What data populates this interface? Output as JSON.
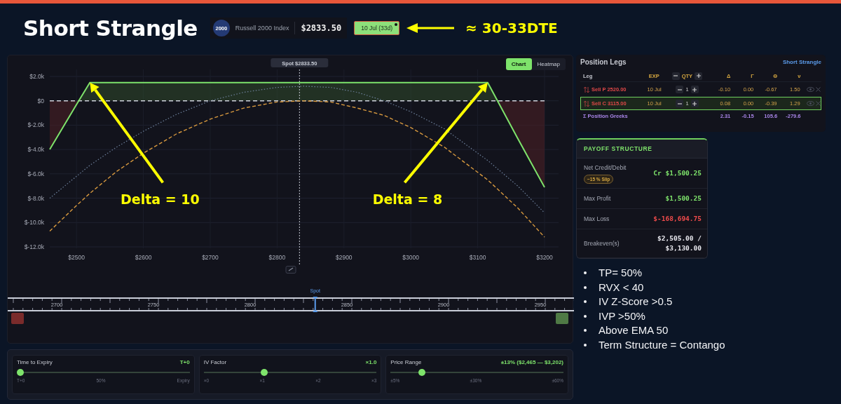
{
  "title": "Short Strangle",
  "underlying": {
    "logo": "2000",
    "name": "Russell 2000 Index",
    "price": "$2833.50"
  },
  "expiry_chip": {
    "label": "10 Jul (33d)",
    "alert": true
  },
  "dte_note": "≈ 30-33DTE",
  "chart_panel": {
    "view_tabs": [
      {
        "label": "Chart",
        "selected": true
      },
      {
        "label": "Heatmap",
        "selected": false
      }
    ],
    "chart_data": {
      "type": "line",
      "x": [
        2460,
        2500,
        2520,
        2560,
        2600,
        2650,
        2700,
        2750,
        2800,
        2840,
        2880,
        2920,
        2960,
        3000,
        3050,
        3115,
        3160,
        3200
      ],
      "series": [
        {
          "line_style": "solid",
          "color": "#7ee36b",
          "values": [
            -4000,
            -300,
            1500,
            1500,
            1500,
            1500,
            1500,
            1500,
            1500,
            1500,
            1500,
            1500,
            1500,
            1500,
            1500,
            1500,
            -3100,
            -7100
          ]
        },
        {
          "line_style": "dotted",
          "color": "#6e819c",
          "values": [
            -8000,
            -6200,
            -5300,
            -3800,
            -2500,
            -1100,
            0,
            700,
            1100,
            1200,
            1100,
            700,
            0,
            -900,
            -2300,
            -4900,
            -7000,
            -9200
          ]
        },
        {
          "line_style": "dashed",
          "color": "#d99a3f",
          "values": [
            -10700,
            -8600,
            -7600,
            -5800,
            -4300,
            -2700,
            -1500,
            -600,
            -100,
            0,
            -100,
            -600,
            -1200,
            -2200,
            -3800,
            -6500,
            -8800,
            -11200
          ]
        }
      ],
      "grid": true,
      "ref_lines": [
        {
          "axis": "y",
          "value": 0,
          "color": "#cfd3dc"
        },
        {
          "axis": "x",
          "value": 2833.5,
          "label": "Spot $2833.50",
          "color": "#c8ccd6"
        }
      ],
      "xlim": [
        2460,
        3200
      ],
      "ylim": [
        -12000,
        2000
      ],
      "xticks": [
        {
          "value": 2500,
          "label": "$2500"
        },
        {
          "value": 2600,
          "label": "$2600"
        },
        {
          "value": 2700,
          "label": "$2700"
        },
        {
          "value": 2800,
          "label": "$2800"
        },
        {
          "value": 2900,
          "label": "$2900"
        },
        {
          "value": 3000,
          "label": "$3000"
        },
        {
          "value": 3100,
          "label": "$3100"
        },
        {
          "value": 3200,
          "label": "$3200"
        }
      ],
      "yticks": [
        {
          "value": 2000,
          "label": "$2.0k"
        },
        {
          "value": 0,
          "label": "$0"
        },
        {
          "value": -2000,
          "label": "$-2.0k"
        },
        {
          "value": -4000,
          "label": "$-4.0k"
        },
        {
          "value": -6000,
          "label": "$-6.0k"
        },
        {
          "value": -8000,
          "label": "$-8.0k"
        },
        {
          "value": -10000,
          "label": "$-10.0k"
        },
        {
          "value": -12000,
          "label": "$-12.0k"
        }
      ],
      "annotations": [
        "Delta = 10",
        "Delta = 8"
      ]
    },
    "ruler": {
      "ticks": [
        "2700",
        "2750",
        "2800",
        "2850",
        "2900",
        "2950"
      ],
      "spot_label": "Spot",
      "level": 0.543
    }
  },
  "sliders": [
    {
      "label": "Time to Expiry",
      "value": "T+0",
      "level": 0.0,
      "ticks": [
        "T+0",
        "50%",
        "Expiry"
      ]
    },
    {
      "label": "IV Factor",
      "value": "×1.0",
      "level": 0.33,
      "ticks": [
        "×0",
        "×1",
        "×2",
        "×3"
      ]
    },
    {
      "label": "Price Range",
      "value": "±13% ($2,465 — $3,202)",
      "level": 0.16,
      "ticks": [
        "±5%",
        "±30%",
        "±60%"
      ]
    }
  ],
  "legs_panel": {
    "title": "Position Legs",
    "strategy": "Short Strangle",
    "columns": [
      "Leg",
      "EXP",
      "QTY",
      "Δ",
      "Γ",
      "Θ",
      "ν"
    ],
    "legs": [
      {
        "name": "Sell P 2520.00",
        "exp": "10 Jul",
        "qty": "1",
        "delta": "-0.10",
        "gamma": "0.00",
        "theta": "-0.67",
        "vega": "1.50",
        "selected": false
      },
      {
        "name": "Sell C 3115.00",
        "exp": "10 Jul",
        "qty": "1",
        "delta": "0.08",
        "gamma": "0.00",
        "theta": "-0.39",
        "vega": "1.29",
        "selected": true
      }
    ],
    "totals": {
      "label": "Σ Position Greeks",
      "delta": "2.31",
      "gamma": "-0.15",
      "theta": "105.6",
      "vega": "-279.6"
    }
  },
  "payoff": {
    "title": "PAYOFF STRUCTURE",
    "rows": [
      {
        "label": "Net Credit/Debit",
        "value": "Cr $1,500.25",
        "color": "#7ee36b",
        "badge": "−15 % Slip"
      },
      {
        "label": "Max Profit",
        "value": "$1,500.25",
        "color": "#7ee36b"
      },
      {
        "label": "Max Loss",
        "value": "$-168,694.75",
        "color": "#ef4b4b"
      },
      {
        "label": "Breakeven(s)",
        "value": "$2,505.00 / $3,130.00",
        "color": "#e8e8ee"
      }
    ]
  },
  "bullets": [
    "TP= 50%",
    "RVX < 40",
    "IV Z-Score >0.5",
    "IVP >50%",
    "Above EMA 50",
    "Term Structure = Contango"
  ]
}
